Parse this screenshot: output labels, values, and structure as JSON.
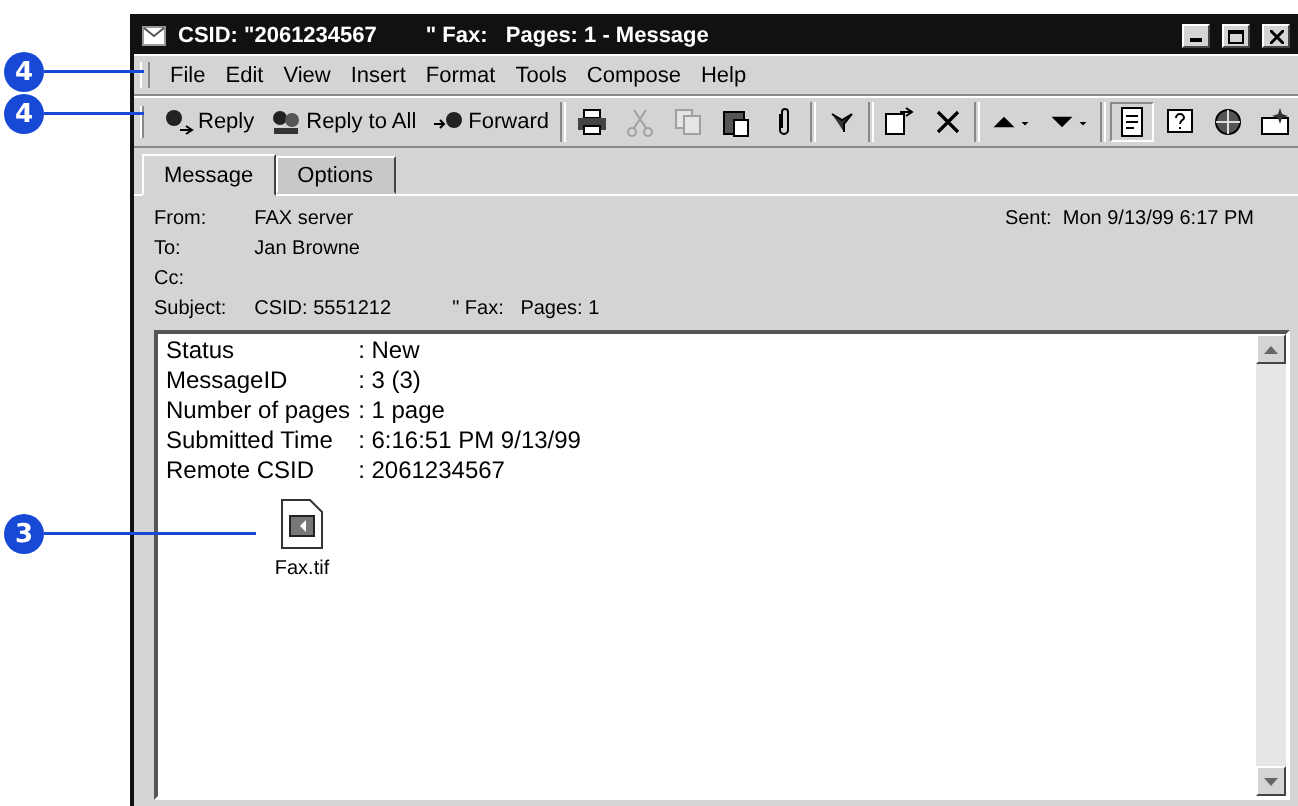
{
  "callouts": [
    {
      "number": "4"
    },
    {
      "number": "4"
    },
    {
      "number": "3"
    }
  ],
  "window": {
    "title": "CSID: \"2061234567        \" Fax:   Pages: 1 - Message"
  },
  "menu": [
    "File",
    "Edit",
    "View",
    "Insert",
    "Format",
    "Tools",
    "Compose",
    "Help"
  ],
  "toolbar": [
    {
      "kind": "reply",
      "label": "Reply",
      "disabled": false
    },
    {
      "kind": "reply_all",
      "label": "Reply to All",
      "disabled": false
    },
    {
      "kind": "forward",
      "label": "Forward",
      "disabled": false
    },
    {
      "kind": "separator"
    },
    {
      "kind": "print",
      "disabled": false
    },
    {
      "kind": "cut",
      "disabled": true
    },
    {
      "kind": "copy",
      "disabled": true
    },
    {
      "kind": "paste",
      "disabled": false
    },
    {
      "kind": "attach",
      "disabled": false
    },
    {
      "kind": "separator"
    },
    {
      "kind": "flag",
      "disabled": false
    },
    {
      "kind": "separator"
    },
    {
      "kind": "move",
      "disabled": false
    },
    {
      "kind": "delete",
      "disabled": false
    },
    {
      "kind": "separator"
    },
    {
      "kind": "previous",
      "disabled": false
    },
    {
      "kind": "next",
      "disabled": false
    },
    {
      "kind": "separator"
    },
    {
      "kind": "properties",
      "disabled": false,
      "pressed": true
    },
    {
      "kind": "help",
      "disabled": false
    },
    {
      "kind": "address",
      "disabled": false
    },
    {
      "kind": "tracking",
      "disabled": false
    }
  ],
  "tabs": [
    {
      "label": "Message",
      "selected": true
    },
    {
      "label": "Options",
      "selected": false
    }
  ],
  "header": {
    "from": {
      "label": "From:",
      "value": "FAX server"
    },
    "sent": {
      "label": "Sent:",
      "value": "Mon 9/13/99 6:17 PM"
    },
    "to": {
      "label": "To:",
      "value": "Jan Browne"
    },
    "cc": {
      "label": "Cc:"
    },
    "subject": {
      "label": "Subject:",
      "value": "CSID: 5551212           \" Fax:   Pages: 1"
    }
  },
  "body": {
    "lines": [
      {
        "label": "Status",
        "value": ": New"
      },
      {
        "label": "MessageID",
        "value": ": 3 (3)"
      },
      {
        "label": "Number of pages",
        "value": ": 1 page"
      },
      {
        "label": "Submitted Time",
        "value": ": 6:16:51 PM 9/13/99"
      },
      {
        "label": "Remote CSID",
        "value": ": 2061234567"
      }
    ],
    "attachment": {
      "name": "Fax.tif"
    }
  }
}
